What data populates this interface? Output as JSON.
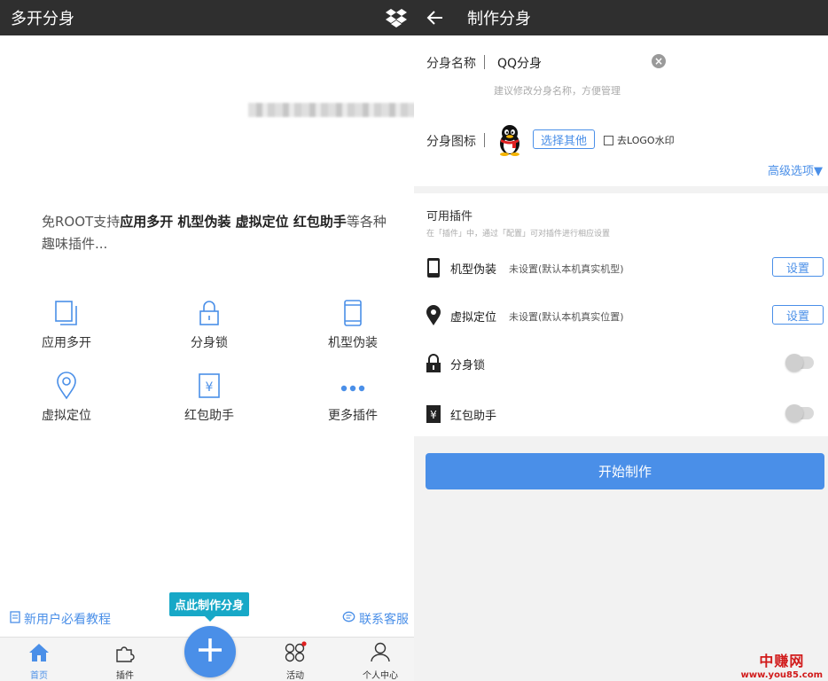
{
  "left": {
    "title": "多开分身",
    "intro": {
      "prefix": "免ROOT支持",
      "bold": "应用多开 机型伪装 虚拟定位 红包助手",
      "suffix": "等各种趣味插件..."
    },
    "features": [
      {
        "label": "应用多开",
        "icon": "copy-icon"
      },
      {
        "label": "分身锁",
        "icon": "lock-icon"
      },
      {
        "label": "机型伪装",
        "icon": "phone-icon"
      },
      {
        "label": "虚拟定位",
        "icon": "location-pin-icon"
      },
      {
        "label": "红包助手",
        "icon": "red-packet-icon"
      },
      {
        "label": "更多插件",
        "icon": "more-dots-icon"
      }
    ],
    "tutorial_link": "新用户必看教程",
    "service_link": "联系客服",
    "fab_tip": "点此制作分身",
    "tabs": [
      {
        "label": "首页",
        "icon": "home-icon",
        "active": true
      },
      {
        "label": "插件",
        "icon": "puzzle-icon",
        "active": false
      },
      {
        "label": "活动",
        "icon": "activity-icon",
        "active": false
      },
      {
        "label": "个人中心",
        "icon": "user-icon",
        "active": false
      }
    ]
  },
  "right": {
    "title": "制作分身",
    "name_label": "分身名称",
    "name_value": "QQ分身",
    "name_hint": "建议修改分身名称，方便管理",
    "icon_label": "分身图标",
    "choose_other": "选择其他",
    "remove_logo": "去LOGO水印",
    "advanced": "高级选项▼",
    "plugins_title": "可用插件",
    "plugins_sub": "在「插件」中，通过「配置」可对插件进行相应设置",
    "plugins": [
      {
        "name": "机型伪装",
        "status": "未设置(默认本机真实机型)",
        "action": "设置",
        "icon": "phone-icon"
      },
      {
        "name": "虚拟定位",
        "status": "未设置(默认本机真实位置)",
        "action": "设置",
        "icon": "location-pin-icon"
      },
      {
        "name": "分身锁",
        "toggle": false,
        "icon": "lock-icon"
      },
      {
        "name": "红包助手",
        "toggle": false,
        "icon": "red-packet-icon"
      }
    ],
    "start_button": "开始制作"
  },
  "watermark": {
    "line1": "中赚网",
    "line2": "www.you85.com"
  },
  "colors": {
    "accent": "#4a8fe8",
    "topbar": "#2f2f2f",
    "tip": "#17a8c7",
    "watermark": "#d11a1a"
  }
}
